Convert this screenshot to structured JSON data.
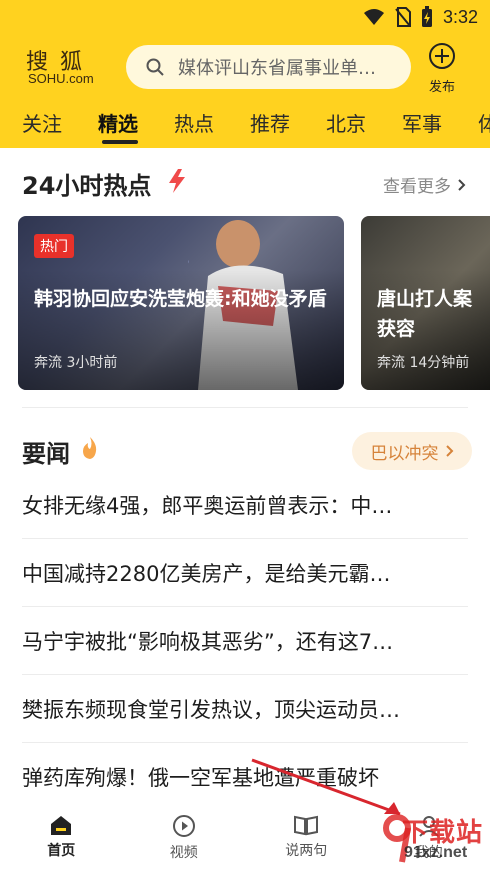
{
  "status_bar": {
    "time": "3:32"
  },
  "header": {
    "logo_cn": "搜狐",
    "logo_en": "SOHU.com",
    "search_placeholder": "媒体评山东省属事业单…",
    "publish_label": "发布"
  },
  "tabs": [
    {
      "label": "关注",
      "active": false
    },
    {
      "label": "精选",
      "active": true
    },
    {
      "label": "热点",
      "active": false
    },
    {
      "label": "推荐",
      "active": false
    },
    {
      "label": "北京",
      "active": false
    },
    {
      "label": "军事",
      "active": false
    },
    {
      "label": "体",
      "active": false
    }
  ],
  "hot_section": {
    "title": "24小时热点",
    "more_label": "查看更多",
    "cards": [
      {
        "badge": "热门",
        "headline": "韩羽协回应安洗莹炮轰:和她没矛盾",
        "source": "奔流",
        "time": "3小时前"
      },
      {
        "headline": "唐山打人案获容",
        "source": "奔流",
        "time": "14分钟前"
      }
    ]
  },
  "news_section": {
    "title": "要闻",
    "topic_pill": "巴以冲突",
    "items": [
      "女排无缘4强，郎平奥运前曾表示：中…",
      "中国减持2280亿美房产，是给美元霸…",
      "马宁宇被批“影响极其恶劣”，还有这7…",
      "樊振东频现食堂引发热议，顶尖运动员…",
      "弹药库殉爆！俄一空军基地遭严重破坏"
    ]
  },
  "bottom_nav": [
    {
      "label": "首页",
      "icon": "home-icon",
      "active": true
    },
    {
      "label": "视频",
      "icon": "play-circle-icon",
      "active": false
    },
    {
      "label": "说两句",
      "icon": "book-icon",
      "active": false
    },
    {
      "label": "我的",
      "icon": "user-icon",
      "active": false
    }
  ],
  "watermark": {
    "text": "下载站",
    "url": "91xz.net"
  },
  "colors": {
    "header_yellow": "#ffd21f",
    "badge_red": "#e8312a",
    "pill_bg": "#fdf1df",
    "pill_text": "#d6833a"
  }
}
